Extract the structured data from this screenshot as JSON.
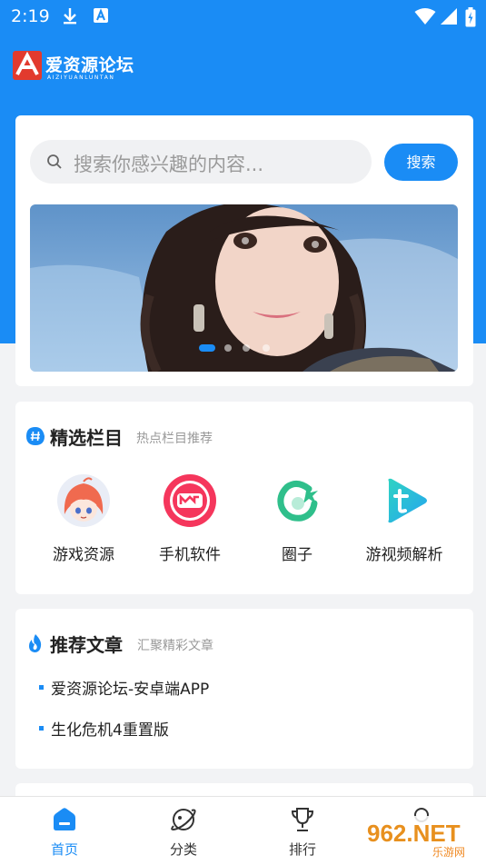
{
  "status_bar": {
    "time": "2:19"
  },
  "header": {
    "logo_text": "爱资源论坛",
    "logo_sub": "AIZIYUANLUNTAN"
  },
  "search": {
    "placeholder": "搜索你感兴趣的内容...",
    "button_label": "搜索"
  },
  "banner": {
    "slide_count": 4,
    "active_slide": 1
  },
  "featured": {
    "title": "精选栏目",
    "subtitle": "热点栏目推荐",
    "items": [
      {
        "label": "游戏资源",
        "icon": "anime-girl-avatar-icon"
      },
      {
        "label": "手机软件",
        "icon": "meitu-app-icon"
      },
      {
        "label": "圈子",
        "icon": "circle-app-icon"
      },
      {
        "label": "游视频解析",
        "icon": "video-play-icon"
      }
    ]
  },
  "articles": {
    "title": "推荐文章",
    "subtitle": "汇聚精彩文章",
    "items": [
      "爱资源论坛-安卓端APP",
      "生化危机4重置版"
    ]
  },
  "tabs": [
    {
      "label": "首页",
      "icon": "home-icon",
      "active": true
    },
    {
      "label": "分类",
      "icon": "category-planet-icon",
      "active": false
    },
    {
      "label": "排行",
      "icon": "trophy-icon",
      "active": false
    },
    {
      "label": "",
      "icon": "profile-icon",
      "active": false
    }
  ],
  "watermark": {
    "text": "962.NET",
    "sub": "乐游网"
  },
  "colors": {
    "brand": "#1a8cf5",
    "background": "#f2f3f5"
  }
}
